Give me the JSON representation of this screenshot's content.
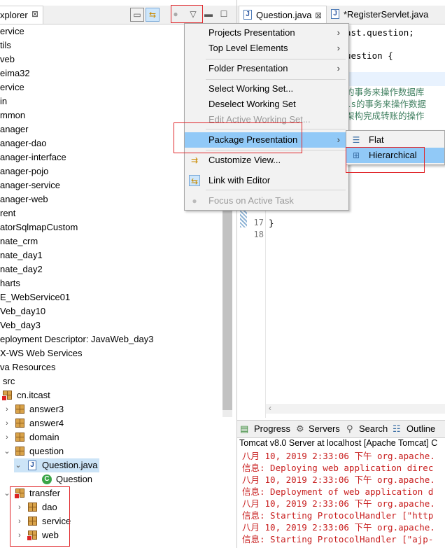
{
  "explorer": {
    "tab_label": "xplorer",
    "close_glyph": "⊠",
    "tree": [
      {
        "label": "ervice"
      },
      {
        "label": "tils"
      },
      {
        "label": "veb"
      },
      {
        "label": "eima32"
      },
      {
        "label": "ervice"
      },
      {
        "label": "in"
      },
      {
        "label": "mmon"
      },
      {
        "label": "anager"
      },
      {
        "label": "anager-dao"
      },
      {
        "label": "anager-interface"
      },
      {
        "label": "anager-pojo"
      },
      {
        "label": "anager-service"
      },
      {
        "label": "anager-web"
      },
      {
        "label": "rent"
      },
      {
        "label": "atorSqlmapCustom"
      },
      {
        "label": "nate_crm"
      },
      {
        "label": "nate_day1"
      },
      {
        "label": "nate_day2"
      },
      {
        "label": "harts"
      },
      {
        "label": "E_WebService01"
      },
      {
        "label": "Veb_day10"
      },
      {
        "label": "Veb_day3"
      },
      {
        "label": "eployment Descriptor: JavaWeb_day3"
      },
      {
        "label": "X-WS Web Services"
      },
      {
        "label": "va Resources"
      },
      {
        "label": "src"
      },
      {
        "label": "cn.itcast"
      },
      {
        "label": "answer3"
      },
      {
        "label": "answer4"
      },
      {
        "label": "domain"
      },
      {
        "label": "question"
      },
      {
        "label": "Question.java"
      },
      {
        "label": "Question"
      },
      {
        "label": "transfer"
      },
      {
        "label": "dao"
      },
      {
        "label": "service"
      },
      {
        "label": "web"
      }
    ]
  },
  "editor": {
    "tabs": [
      {
        "label": "Question.java",
        "close": "⊠"
      },
      {
        "label": "*RegisterServlet.java"
      }
    ],
    "code_lines": [
      "ast.question;",
      "uestion {",
      "的事务来操作数据库",
      "ls的事务来操作数据",
      "架构完成转账的操作",
      "}"
    ],
    "line_numbers": [
      "17",
      "18"
    ]
  },
  "menu": {
    "items": [
      {
        "label": "Projects Presentation",
        "arrow": "›"
      },
      {
        "label": "Top Level Elements",
        "arrow": "›"
      },
      {
        "label": "Folder Presentation",
        "arrow": "›"
      },
      {
        "label": "Select Working Set..."
      },
      {
        "label": "Deselect Working Set"
      },
      {
        "label": "Edit Active Working Set..."
      },
      {
        "label": "Package Presentation",
        "arrow": "›"
      },
      {
        "label": "Customize View..."
      },
      {
        "label": "Link with Editor"
      },
      {
        "label": "Focus on Active Task"
      }
    ],
    "submenu": [
      {
        "label": "Flat"
      },
      {
        "label": "Hierarchical"
      }
    ]
  },
  "console": {
    "tabs": [
      {
        "label": "Progress"
      },
      {
        "label": "Servers"
      },
      {
        "label": "Search"
      },
      {
        "label": "Outline"
      }
    ],
    "title": "Tomcat v8.0 Server at localhost [Apache Tomcat] C",
    "lines": [
      "八月 10, 2019 2:33:06 下午 org.apache.",
      "信息: Deploying web application direc",
      "八月 10, 2019 2:33:06 下午 org.apache.",
      "信息: Deployment of web application d",
      "八月 10, 2019 2:33:06 下午 org.apache.",
      "信息: Starting ProtocolHandler [\"http",
      "八月 10, 2019 2:33:06 下午 org.apache.",
      "信息: Starting ProtocolHandler [\"ajp-"
    ]
  }
}
